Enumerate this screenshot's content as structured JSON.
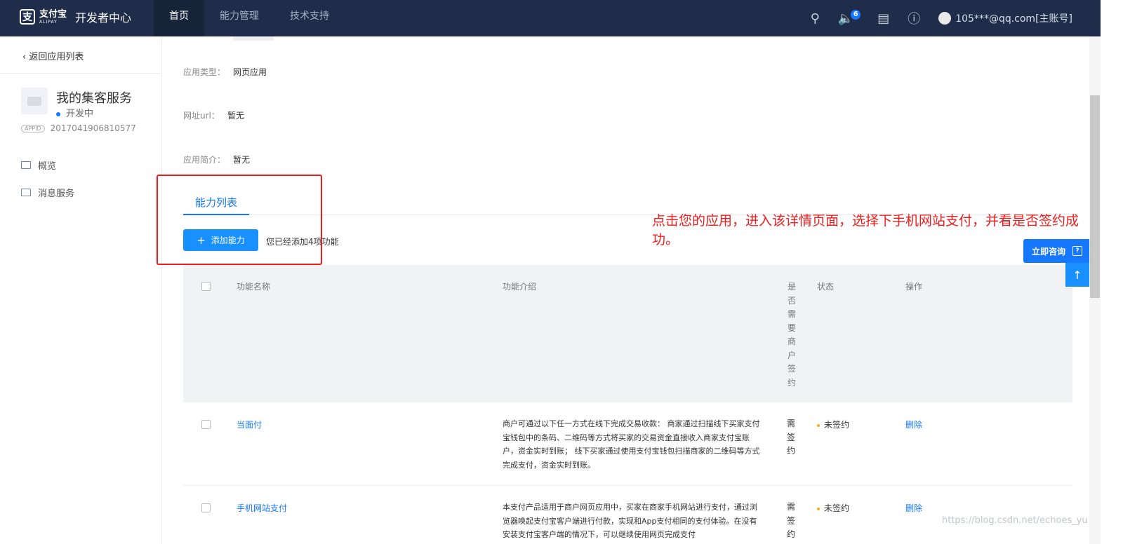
{
  "header": {
    "logo_cn": "支付宝",
    "logo_en": "ALIPAY",
    "title": "开发者中心",
    "nav": [
      "首页",
      "能力管理",
      "技术支持"
    ],
    "notification_count": "6",
    "user": "105***@qq.com[主账号]"
  },
  "sidebar": {
    "back": "返回应用列表",
    "app_name": "我的集客服务",
    "app_status": "开发中",
    "appid_tag": "APPID",
    "appid": "2017041906810577",
    "menu": [
      "概览",
      "消息服务"
    ]
  },
  "details": {
    "app_type_label": "应用类型：",
    "app_type": "网页应用",
    "url_label": "网址url：",
    "url": "暂无",
    "intro_label": "应用简介：",
    "intro": "暂无"
  },
  "capability": {
    "tab": "能力列表",
    "add_button": "添加能力",
    "added_text": "您已经添加4项功能"
  },
  "table": {
    "headers": {
      "name": "功能名称",
      "desc": "功能介绍",
      "need_sign": [
        "是",
        "否",
        "需",
        "要",
        "商",
        "户",
        "签",
        "约"
      ],
      "status": "状态",
      "op": "操作"
    },
    "rows": [
      {
        "name": "当面付",
        "desc": "商户可通过以下任一方式在线下完成交易收款： 商家通过扫描线下买家支付宝钱包中的条码、二维码等方式将买家的交易资金直接收入商家支付宝账户，资金实时到账； 线下买家通过使用支付宝钱包扫描商家的二维码等方式完成支付，资金实时到账。",
        "need_sign": [
          "需",
          "签",
          "约"
        ],
        "status": "未签约",
        "op": "删除"
      },
      {
        "name": "手机网站支付",
        "desc": "本支付产品适用于商户网页应用中，买家在商家手机网站进行支付，通过浏览器唤起支付宝客户端进行付款，实现和App支付相同的支付体验。在没有安装支付宝客户端的情况下，可以继续使用网页完成支付",
        "need_sign": [
          "需",
          "签",
          "约"
        ],
        "status": "未签约",
        "op": "删除"
      }
    ]
  },
  "annotation": "点击您的应用，进入该详情页面，选择下手机网站支付，并看是否签约成功。",
  "float": {
    "consult": "立即咨询",
    "consult_icon": "?",
    "totop": "↑"
  },
  "watermark": "https://blog.csdn.net/echoes_yu"
}
